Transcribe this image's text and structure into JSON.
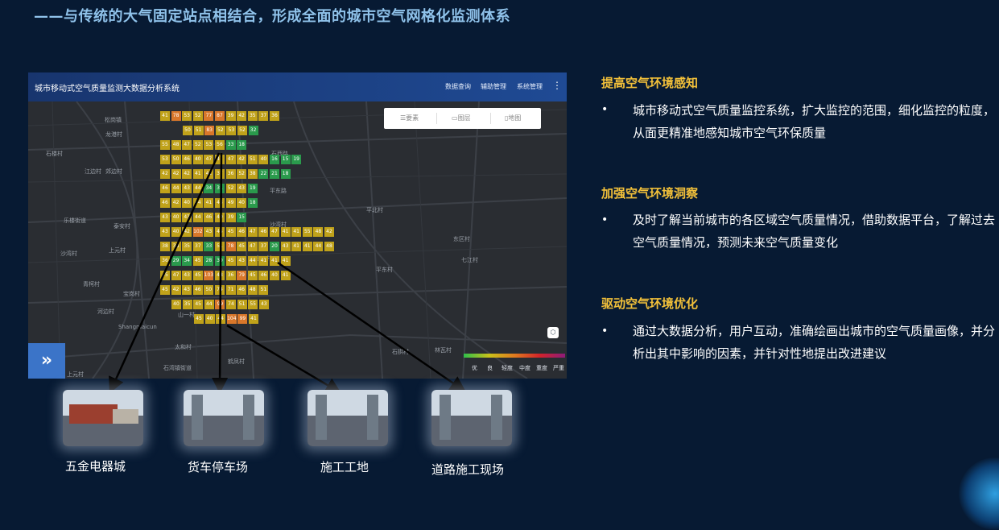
{
  "headline": "——与传统的大气固定站点相结合，形成全面的城市空气网格化监测体系",
  "app": {
    "title": "城市移动式空气质量监测大数据分析系统",
    "nav": [
      "数据查询",
      "辅助管理",
      "系统管理"
    ],
    "more_icon": "vertical-dots-icon",
    "map_controls": [
      "要素",
      "图层",
      "地图"
    ],
    "expand_icon": "double-chevron-right-icon",
    "legend": [
      "优",
      "良",
      "轻度",
      "中度",
      "重度",
      "严重"
    ],
    "legend_colors": [
      "#2fbf4a",
      "#c9c21a",
      "#e07b1f",
      "#d2232a",
      "#8e1b7a"
    ],
    "places": [
      "松岗镇",
      "龙港村",
      "石楼村",
      "江边村",
      "郊边村",
      "乐楼街道",
      "泰安村",
      "沙湾村",
      "上元村",
      "青柯村",
      "宝岗村",
      "河边村",
      "山一村",
      "太和村",
      "石湾镇街道",
      "鹤凤村",
      "上元村",
      "石拱村",
      "林瓦村",
      "平北村",
      "东区村",
      "七江村",
      "平东村",
      "东二村",
      "石西路",
      "平东路",
      "沙湾村",
      "Shangmaicun"
    ],
    "grid_values": {
      "row1": [
        "41",
        "78",
        "53",
        "52",
        "77",
        "87",
        "39",
        "42",
        "35",
        "37",
        "36"
      ],
      "row2": [
        "50",
        "51",
        "83",
        "52",
        "53",
        "52",
        "32"
      ],
      "row3": [
        "55",
        "48",
        "47",
        "52",
        "53",
        "56",
        "33",
        "18"
      ],
      "row4": [
        "53",
        "50",
        "46",
        "40",
        "47",
        "47",
        "47",
        "42",
        "51",
        "40",
        "16",
        "15",
        "19"
      ],
      "row5": [
        "42",
        "42",
        "42",
        "41",
        "41",
        "37",
        "36",
        "52",
        "38",
        "22",
        "21",
        "18"
      ],
      "row6": [
        "46",
        "44",
        "43",
        "44",
        "34",
        "31",
        "52",
        "43",
        "19"
      ],
      "row7": [
        "46",
        "42",
        "40",
        "44",
        "41",
        "43",
        "49",
        "40",
        "18"
      ],
      "row8": [
        "43",
        "40",
        "43",
        "44",
        "46",
        "40",
        "39",
        "15"
      ],
      "row9": [
        "43",
        "40",
        "42",
        "102",
        "43",
        "45",
        "45",
        "46",
        "47",
        "46",
        "47",
        "41",
        "41",
        "55",
        "48",
        "42"
      ],
      "row10": [
        "38",
        "38",
        "35",
        "37",
        "33",
        "51",
        "78",
        "45",
        "47",
        "37",
        "20",
        "43",
        "41",
        "41",
        "44",
        "48"
      ],
      "row11": [
        "36",
        "29",
        "34",
        "45",
        "28",
        "30",
        "45",
        "43",
        "44",
        "41",
        "41",
        "41"
      ],
      "row12": [
        "45",
        "47",
        "43",
        "45",
        "103",
        "48",
        "36",
        "79",
        "45",
        "46",
        "40",
        "41"
      ],
      "row13": [
        "45",
        "42",
        "43",
        "46",
        "50",
        "74",
        "71",
        "46",
        "48",
        "51"
      ],
      "row14": [
        "40",
        "35",
        "45",
        "44",
        "99",
        "74",
        "51",
        "55",
        "43"
      ],
      "row15": [
        "45",
        "40",
        "44",
        "104",
        "99",
        "41"
      ]
    }
  },
  "photos": [
    {
      "label": "五金电器城"
    },
    {
      "label": "货车停车场"
    },
    {
      "label": "施工工地"
    },
    {
      "label": "道路施工现场"
    }
  ],
  "sections": [
    {
      "title": "提高空气环境感知",
      "bullet": "•",
      "text": "城市移动式空气质量监控系统，扩大监控的范围，细化监控的粒度，从面更精准地感知城市空气环保质量"
    },
    {
      "title": "加强空气环境洞察",
      "bullet": "•",
      "text": "及时了解当前城市的各区域空气质量情况，借助数据平台，了解过去空气质量情况，预测未来空气质量变化"
    },
    {
      "title": "驱动空气环境优化",
      "bullet": "•",
      "text": "通过大数据分析，用户互动，准确绘画出城市的空气质量画像，并分析出其中影响的因素，并针对性地提出改进建议"
    }
  ]
}
